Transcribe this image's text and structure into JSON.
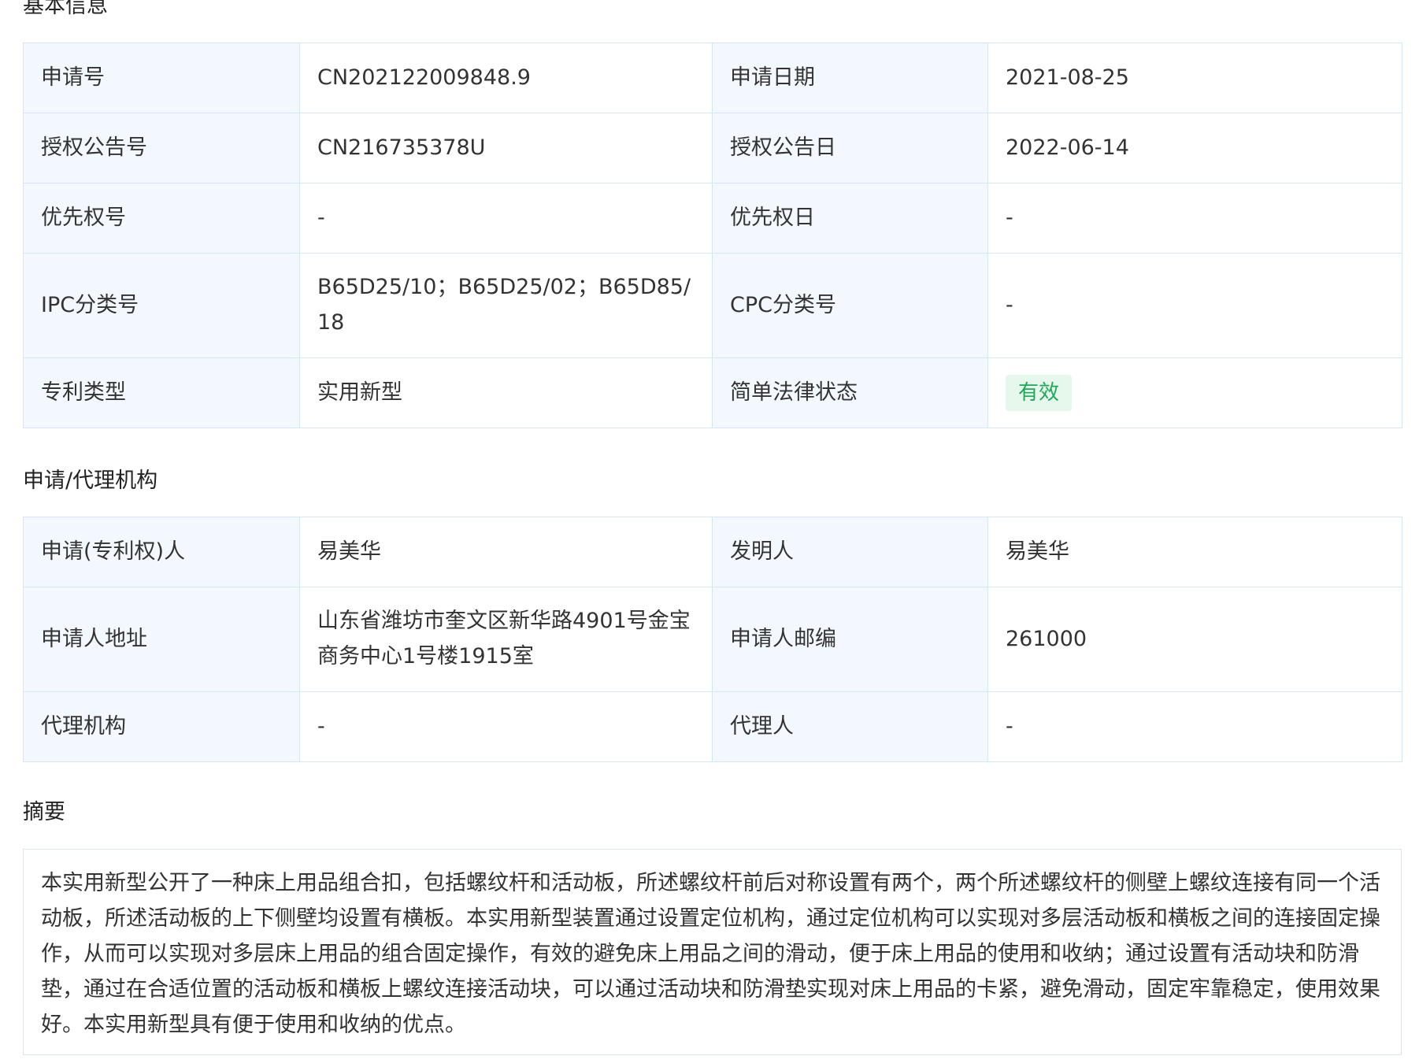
{
  "sections": {
    "basic": "基本信息",
    "applicant": "申请/代理机构",
    "abstract": "摘要"
  },
  "basic": {
    "application_no": {
      "label": "申请号",
      "value": "CN202122009848.9"
    },
    "application_date": {
      "label": "申请日期",
      "value": "2021-08-25"
    },
    "grant_pub_no": {
      "label": "授权公告号",
      "value": "CN216735378U"
    },
    "grant_pub_date": {
      "label": "授权公告日",
      "value": "2022-06-14"
    },
    "priority_no": {
      "label": "优先权号",
      "value": "-"
    },
    "priority_date": {
      "label": "优先权日",
      "value": "-"
    },
    "ipc": {
      "label": "IPC分类号",
      "value": "B65D25/10；B65D25/02；B65D85/18"
    },
    "cpc": {
      "label": "CPC分类号",
      "value": "-"
    },
    "patent_type": {
      "label": "专利类型",
      "value": "实用新型"
    },
    "legal_status": {
      "label": "简单法律状态",
      "value": "有效",
      "color": "#1ea85a"
    }
  },
  "applicant": {
    "patentee": {
      "label": "申请(专利权)人",
      "value": "易美华"
    },
    "inventor": {
      "label": "发明人",
      "value": "易美华"
    },
    "address": {
      "label": "申请人地址",
      "value": "山东省潍坊市奎文区新华路4901号金宝商务中心1号楼1915室"
    },
    "postcode": {
      "label": "申请人邮编",
      "value": "261000"
    },
    "agency": {
      "label": "代理机构",
      "value": "-"
    },
    "agent": {
      "label": "代理人",
      "value": "-"
    }
  },
  "abstract": {
    "text": "本实用新型公开了一种床上用品组合扣，包括螺纹杆和活动板，所述螺纹杆前后对称设置有两个，两个所述螺纹杆的侧壁上螺纹连接有同一个活动板，所述活动板的上下侧壁均设置有横板。本实用新型装置通过设置定位机构，通过定位机构可以实现对多层活动板和横板之间的连接固定操作，从而可以实现对多层床上用品的组合固定操作，有效的避免床上用品之间的滑动，便于床上用品的使用和收纳；通过设置有活动块和防滑垫，通过在合适位置的活动板和横板上螺纹连接活动块，可以通过活动块和防滑垫实现对床上用品的卡紧，避免滑动，固定牢靠稳定，使用效果好。本实用新型具有便于使用和收纳的优点。"
  }
}
